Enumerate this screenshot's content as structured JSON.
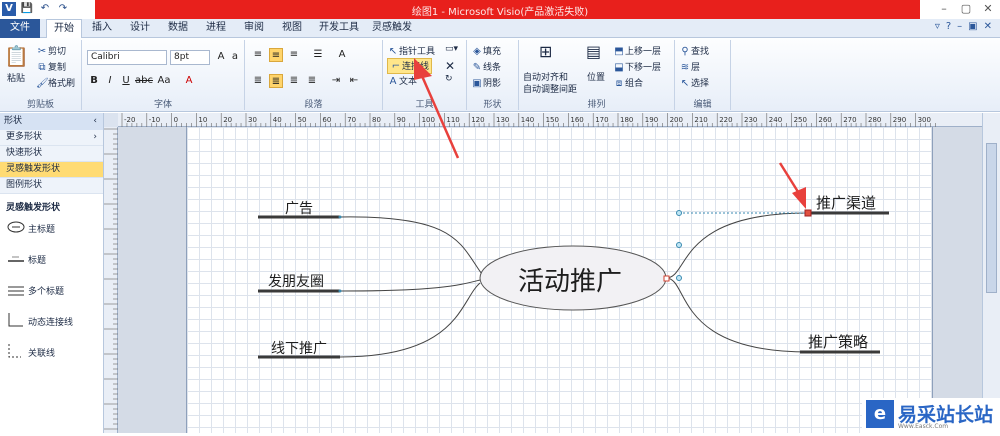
{
  "window": {
    "title": "绘图1 - Microsoft Visio(产品激活失败)"
  },
  "quick_access": [
    "V",
    "💾",
    "↶",
    "↷"
  ],
  "tabs": [
    "文件",
    "开始",
    "插入",
    "设计",
    "数据",
    "进程",
    "审阅",
    "视图",
    "开发工具",
    "灵感触发"
  ],
  "ribbon": {
    "clipboard": {
      "paste": "粘贴",
      "cut": "剪切",
      "copy": "复制",
      "format_painter": "格式刷",
      "label": "剪贴板"
    },
    "font": {
      "name": "Calibri",
      "size": "8pt",
      "label": "字体"
    },
    "paragraph": {
      "label": "段落"
    },
    "tools": {
      "pointer": "指针工具",
      "connector": "连接线",
      "text": "文本",
      "label": "工具"
    },
    "shape": {
      "fill": "填充",
      "line": "线条",
      "shadow": "阴影",
      "label": "形状"
    },
    "arrange": {
      "auto_align": "自动对齐和",
      "auto_space": "自动调整间距",
      "position": "位置",
      "bring_forward": "上移一层",
      "send_backward": "下移一层",
      "group": "组合",
      "label": "排列"
    },
    "edit": {
      "find": "查找",
      "layer": "层",
      "select": "选择",
      "label": "编辑"
    }
  },
  "shapes_pane": {
    "header": "形状",
    "items": [
      "更多形状",
      "快速形状",
      "灵感触发形状",
      "图例形状"
    ],
    "section": "灵感触发形状",
    "shapes": [
      "主标题",
      "标题",
      "多个标题",
      "动态连接线",
      "关联线"
    ]
  },
  "ruler_numbers": [
    "-20",
    "-10",
    "0",
    "10",
    "20",
    "30",
    "40",
    "50",
    "60",
    "70",
    "80",
    "90",
    "100",
    "110",
    "120",
    "130",
    "140",
    "150",
    "160",
    "170",
    "180",
    "190",
    "200",
    "210",
    "220",
    "230",
    "240",
    "250",
    "260",
    "270",
    "280",
    "290",
    "300"
  ],
  "diagram": {
    "center": "活动推广",
    "left_topics": [
      "广告",
      "发朋友圈",
      "线下推广"
    ],
    "right_topics": [
      "推广渠道",
      "推广策略"
    ]
  },
  "watermark": {
    "title": "易采站长站",
    "sub": "Www.Easck.Com"
  },
  "colors": {
    "accent": "#2b579a",
    "title_band": "#e8201c",
    "arrow": "#e8403c",
    "selection": "#ffdb73"
  }
}
